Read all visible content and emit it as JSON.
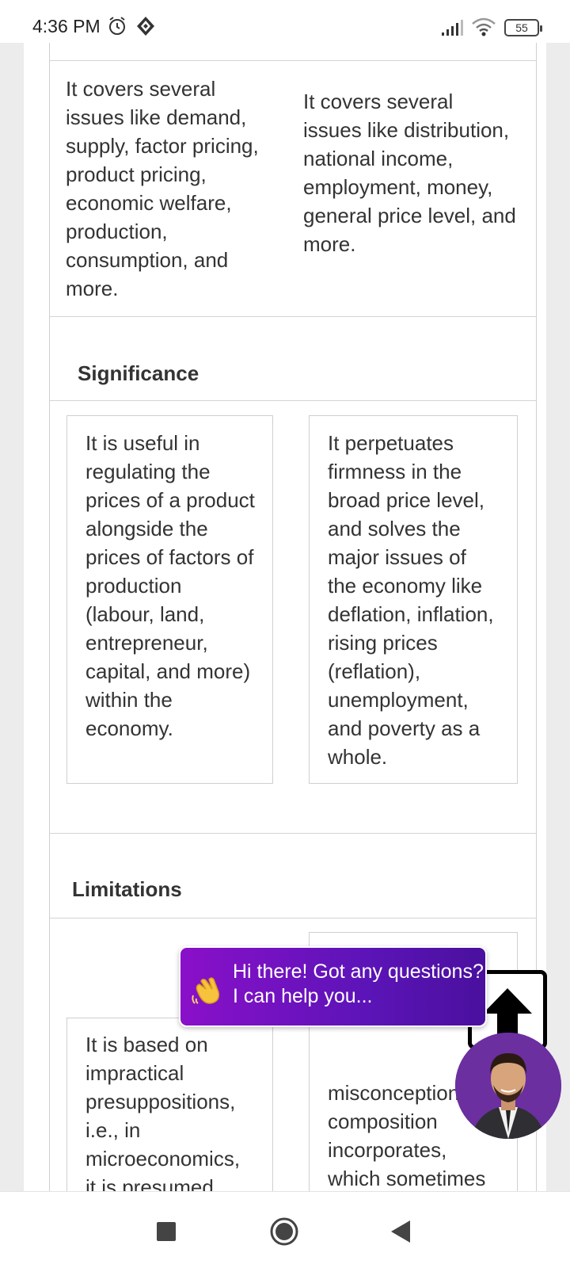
{
  "status_bar": {
    "time": "4:36 PM",
    "battery": "55",
    "icons": [
      "alarm-icon",
      "screen-rotate-icon",
      "signal-icon",
      "wifi-icon",
      "battery-icon"
    ]
  },
  "table": {
    "scope_row": {
      "micro": "It covers several issues like demand, supply, factor pricing, product pricing, economic welfare, production, consumption, and more.",
      "macro": "It covers several issues like distribution, national income, employment, money, general price level, and more."
    },
    "significance": {
      "title": "Significance",
      "micro": "It is useful in regulating the prices of a product alongside the prices of factors of production (labour, land, entrepreneur, capital, and more) within the economy.",
      "macro": "It perpetuates firmness in the broad price level, and solves the major issues of the economy like deflation, inflation, rising prices (reflation), unemployment, and poverty as a whole."
    },
    "limitations": {
      "title": "Limitations",
      "micro": "It is based on impractical presuppositions, i.e., in microeconomics, it is presumed",
      "macro": "misconception of composition incorporates, which sometimes fails to prove accurate"
    }
  },
  "chat": {
    "line1": "Hi there! Got any questions?",
    "line2": "I can help you...",
    "icon": "waving-hand-icon"
  },
  "nav": {
    "icons": [
      "recent-apps-icon",
      "home-icon",
      "back-icon"
    ]
  }
}
